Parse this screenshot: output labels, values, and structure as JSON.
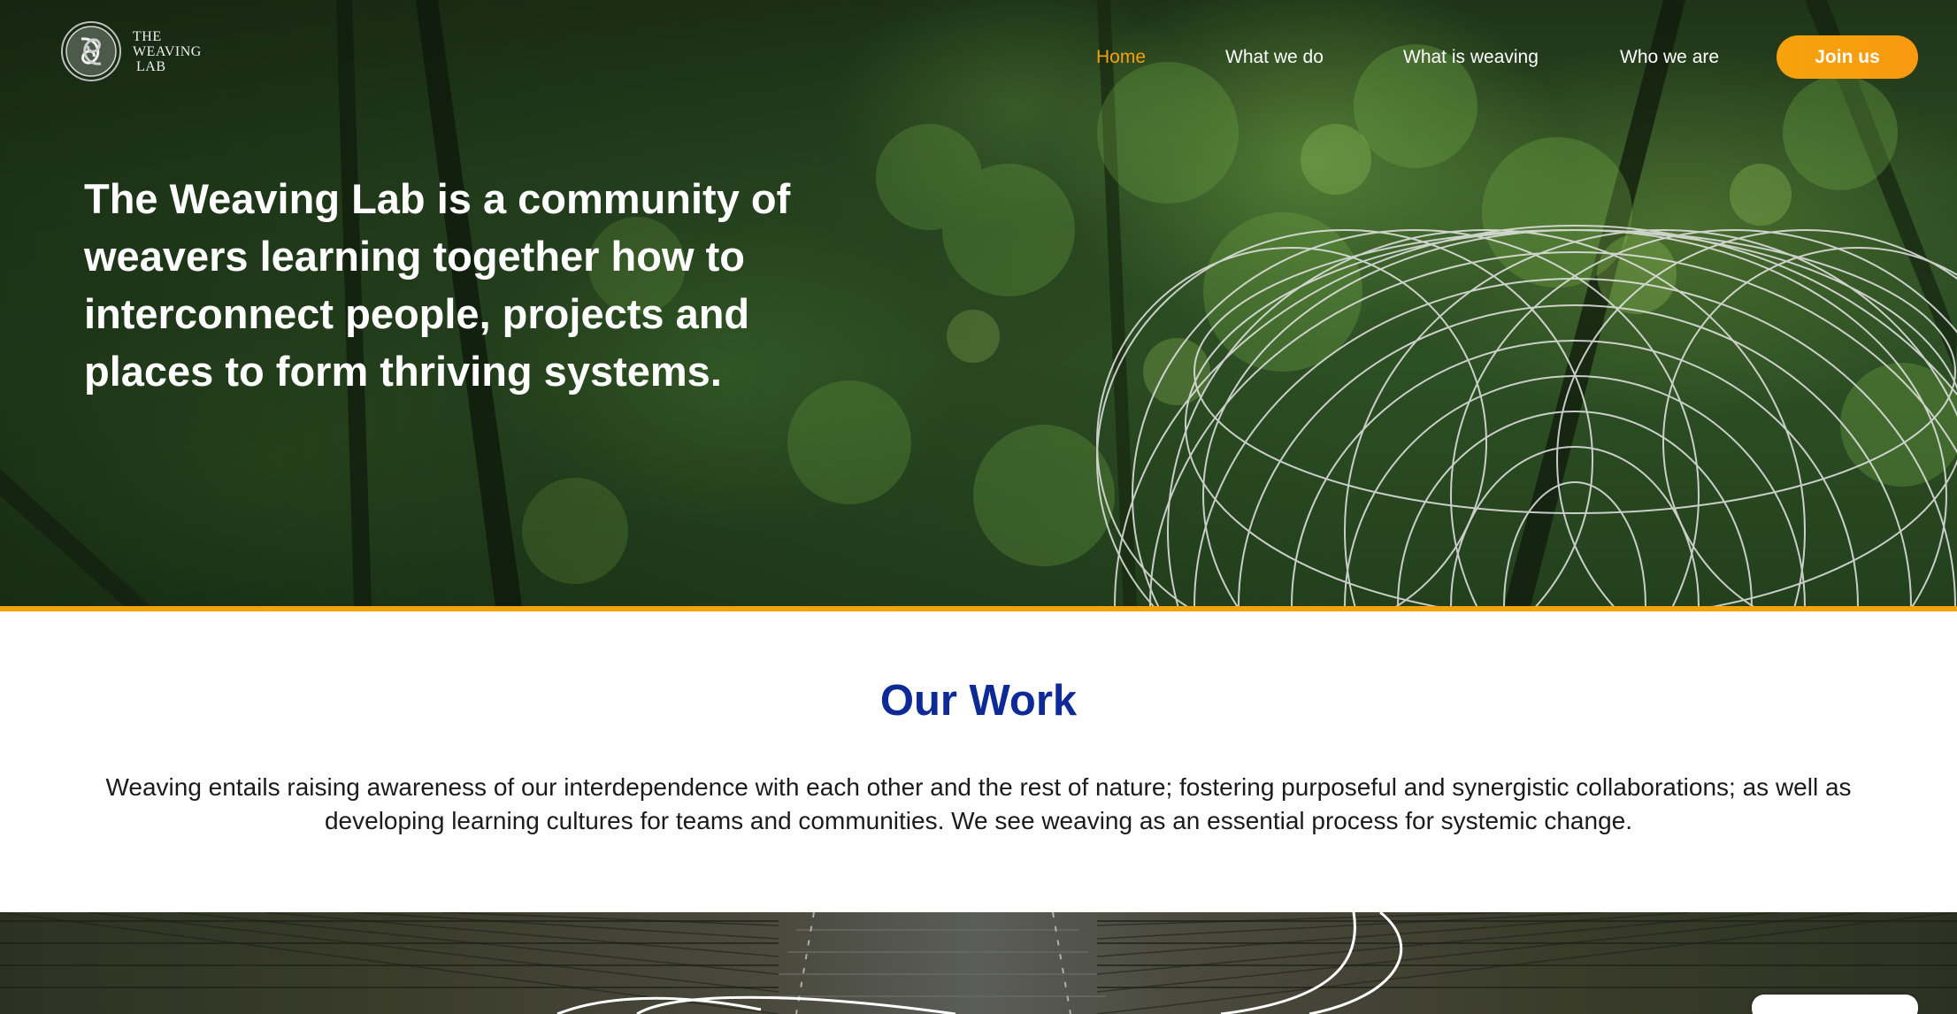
{
  "logo": {
    "line1": "THE",
    "line2": "WEAVING",
    "line3": "LAB"
  },
  "nav": {
    "items": [
      {
        "label": "Home",
        "active": true
      },
      {
        "label": "What we do",
        "active": false
      },
      {
        "label": "What is weaving",
        "active": false
      },
      {
        "label": "Who we are",
        "active": false
      }
    ],
    "cta_label": "Join us"
  },
  "hero": {
    "headline": "The Weaving Lab is a community of weavers learning together how to interconnect people, projects and places to form thriving systems."
  },
  "work": {
    "title": "Our Work",
    "description": "Weaving entails raising awareness of our interdependence with each other and the rest of nature; fostering purposeful and synergistic collaborations; as well as developing learning cultures for teams and communities. We see weaving as an essential process for systemic change."
  },
  "colors": {
    "accent": "#f5a20c",
    "heading_blue": "#0d2a96",
    "text": "#1b1b1b"
  }
}
